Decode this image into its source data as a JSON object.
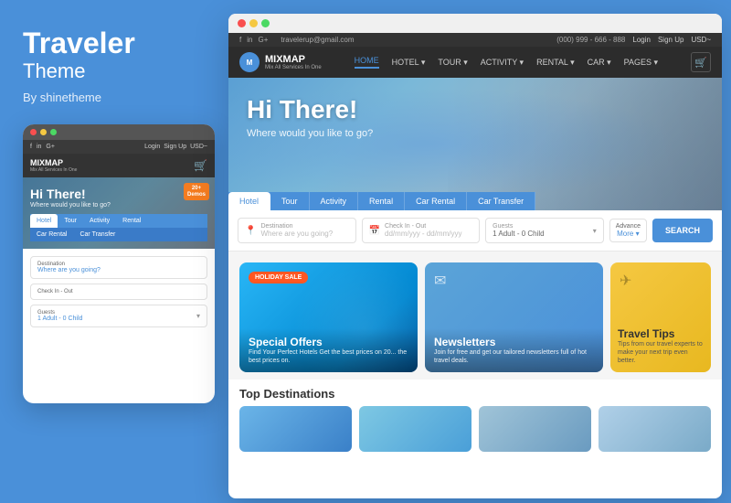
{
  "left": {
    "brand_title": "Traveler",
    "brand_subtitle": "Theme",
    "brand_by": "By shinetheme",
    "mobile": {
      "dots": [
        "red",
        "#f5c842",
        "#4cd964"
      ],
      "nav": {
        "social": [
          "f",
          "in",
          "G+"
        ],
        "links": [
          "Login",
          "Sign Up",
          "USD~"
        ]
      },
      "logo": "MIXMAP",
      "logo_sub": "Mix All Services In One",
      "hero_title": "Hi There!",
      "hero_sub": "Where would you like to go?",
      "demos_badge": "20+\nDemos",
      "tabs": [
        "Hotel",
        "Tour",
        "Activity",
        "Rental",
        "Car Rental",
        "Car Transfer"
      ],
      "active_tab": "Hotel",
      "fields": [
        {
          "label": "Destination",
          "value": "Where are you going?",
          "icon": "📍"
        },
        {
          "label": "Check In - Out",
          "value": "",
          "icon": "📅"
        },
        {
          "label": "Guests",
          "value": "1 Adult - 0 Child",
          "icon": "👤"
        }
      ]
    }
  },
  "main": {
    "window_dots": [
      "#f94f4f",
      "#f5c842",
      "#4cd964"
    ],
    "topbar": {
      "social": [
        "f",
        "in",
        "G+"
      ],
      "email": "travelerup@gmail.com",
      "phone": "(000) 999 - 666 - 888",
      "links": [
        "Login",
        "Sign Up",
        "USD~"
      ]
    },
    "navbar": {
      "logo": "MIXMAP",
      "logo_sub": "Mix All Services In One",
      "nav_links": [
        "HOME",
        "HOTEL",
        "TOUR",
        "ACTIVITY",
        "RENTAL",
        "CAR",
        "PAGES"
      ],
      "active_link": "HOME"
    },
    "hero": {
      "title": "Hi There!",
      "subtitle": "Where would you like to go?"
    },
    "search_tabs": [
      "Hotel",
      "Tour",
      "Activity",
      "Rental",
      "Car Rental",
      "Car Transfer"
    ],
    "active_tab": "Hotel",
    "search_fields": [
      {
        "label": "Destination",
        "placeholder": "Where are you going?",
        "icon": "📍"
      },
      {
        "label": "Check In - Out",
        "placeholder": "dd/mm/yyy - dd/mm/yyy",
        "icon": "📅"
      },
      {
        "label": "Guests",
        "value": "1 Adult - 0 Child",
        "icon": "👤"
      }
    ],
    "advance_label": "Advance",
    "advance_sub": "More ▾",
    "search_btn": "SEARCH",
    "cards": [
      {
        "id": "special-offers",
        "badge": "HOLIDAY SALE",
        "title": "Special Offers",
        "desc": "Find Your Perfect Hotels Get the best prices on 20... the best prices on.",
        "bg": "blue"
      },
      {
        "id": "newsletters",
        "title": "Newsletters",
        "desc": "Join for free and get our tailored newsletters full of hot travel deals.",
        "bg": "light-blue"
      },
      {
        "id": "travel-tips",
        "title": "Travel Tips",
        "desc": "Tips from our travel experts to make your next trip even better.",
        "bg": "yellow"
      }
    ],
    "top_destinations_title": "Top Destinations",
    "dest_cards": [
      1,
      2,
      3,
      4
    ]
  }
}
